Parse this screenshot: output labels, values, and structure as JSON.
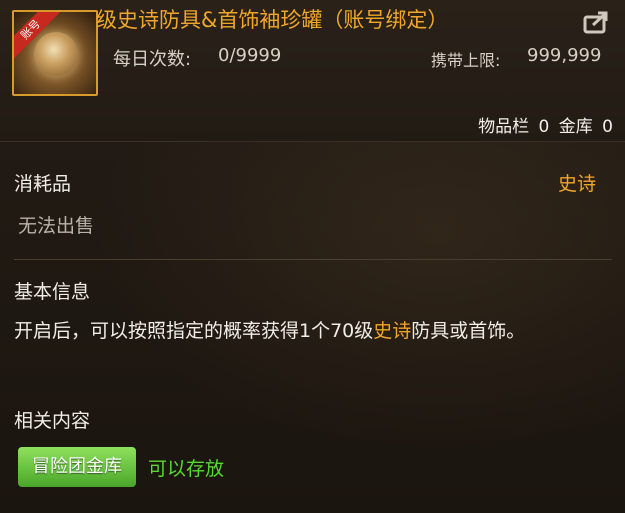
{
  "item": {
    "name": "级史诗防具&首饰袖珍罐（账号绑定）",
    "icon": "golden-jar-icon",
    "ribbon_label": "账号",
    "daily_label": "每日次数:",
    "daily_value": "0/9999",
    "carry_limit_label": "携带上限:",
    "carry_limit_value": "999,999",
    "inventory_label": "物品栏",
    "inventory_value": "0",
    "vault_label": "金库",
    "vault_value": "0",
    "category": "消耗品",
    "rarity": "史诗",
    "sale_status": "无法出售"
  },
  "sections": {
    "basic_info_title": "基本信息",
    "description_part1": "开启后，可以按照指定的概率获得1个70级",
    "description_highlight": "史诗",
    "description_part2": "防具或首饰。",
    "related_title": "相关内容",
    "related_badge": "冒险团金库",
    "related_status": "可以存放"
  },
  "colors": {
    "accent_gold": "#f0a629",
    "green": "#57d92f",
    "badge_green": "#6cc447",
    "ribbon_red": "#c7291f"
  }
}
